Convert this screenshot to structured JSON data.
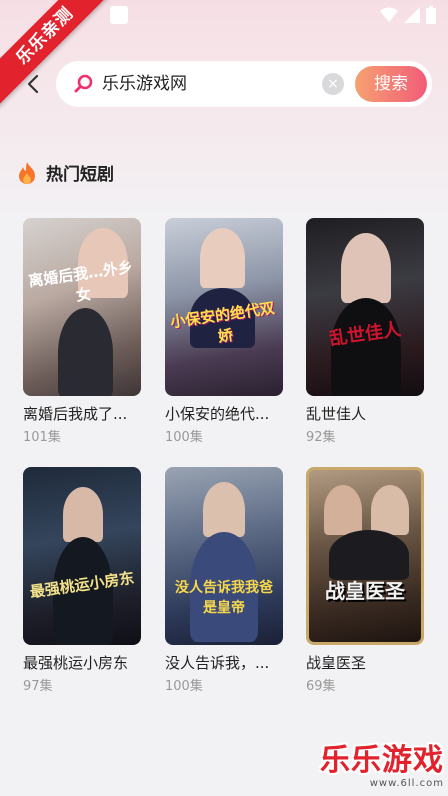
{
  "ribbon": {
    "label": "乐乐亲测"
  },
  "search": {
    "query": "乐乐游戏网",
    "button_label": "搜索",
    "clear_glyph": "×"
  },
  "section": {
    "title": "热门短剧",
    "icon": "fire-icon"
  },
  "dramas": [
    {
      "title": "离婚后我成了...",
      "episodes": "101集",
      "poster_text": "离婚后我…外乡女"
    },
    {
      "title": "小保安的绝代...",
      "episodes": "100集",
      "poster_text": "小保安的绝代双娇"
    },
    {
      "title": "乱世佳人",
      "episodes": "92集",
      "poster_text": "乱世佳人"
    },
    {
      "title": "最强桃运小房东",
      "episodes": "97集",
      "poster_text": "最强桃运小房东"
    },
    {
      "title": "没人告诉我，...",
      "episodes": "100集",
      "poster_text": "没人告诉我我爸是皇帝"
    },
    {
      "title": "战皇医圣",
      "episodes": "69集",
      "poster_text": "战皇医圣"
    }
  ],
  "watermark": {
    "main": "乐乐游戏",
    "sub": "www.6ll.com"
  },
  "colors": {
    "accent": "#f25c79",
    "ribbon": "#e2232d",
    "button_start": "#f6a170"
  }
}
